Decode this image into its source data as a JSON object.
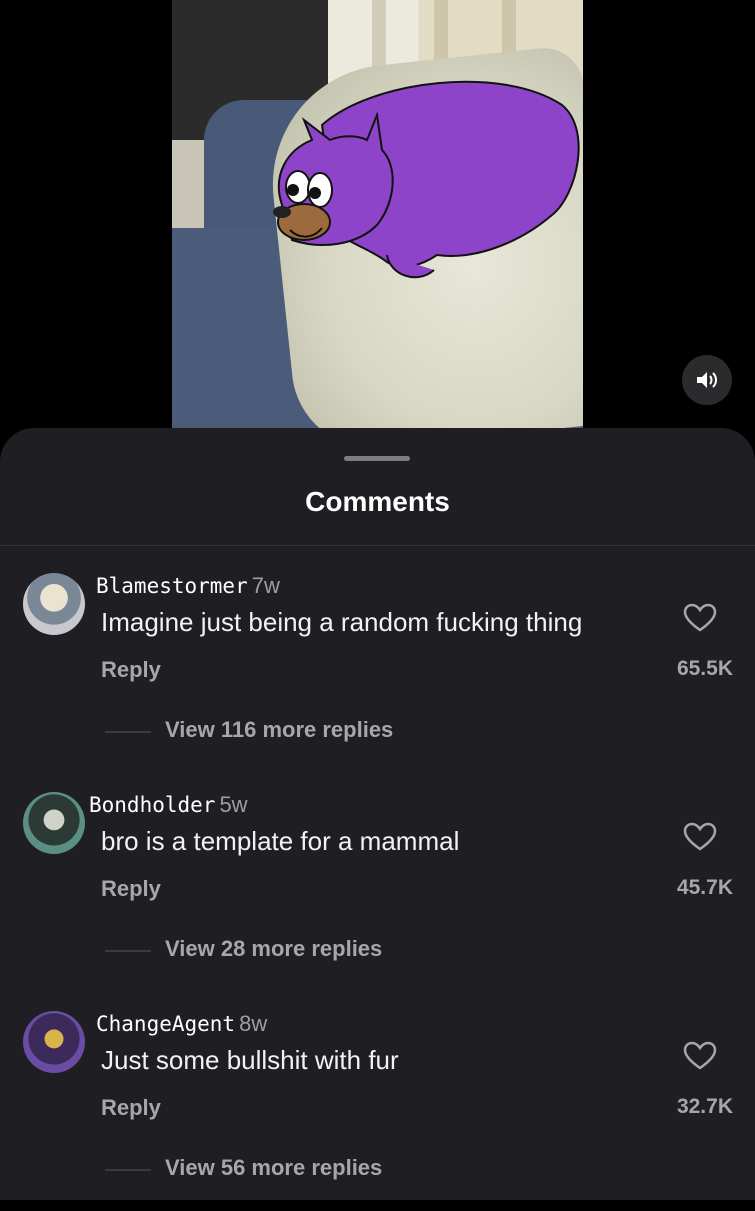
{
  "sheet": {
    "title": "Comments"
  },
  "comments": [
    {
      "username": "Blamestormer",
      "age": "7w",
      "text": "Imagine just being a random fucking thing",
      "reply": "Reply",
      "likes": "65.5K",
      "more": "View 116 more replies"
    },
    {
      "username": "Bondholder",
      "age": "5w",
      "text": "bro is a template for a mammal",
      "reply": "Reply",
      "likes": "45.7K",
      "more": "View 28 more replies"
    },
    {
      "username": "ChangeAgent",
      "age": "8w",
      "text": "Just some bullshit with fur",
      "reply": "Reply",
      "likes": "32.7K",
      "more": "View 56 more replies"
    }
  ],
  "icons": {
    "sound": "speaker-icon",
    "like": "heart-icon"
  },
  "colors": {
    "sheet_bg": "#1f1f23",
    "muted_text": "#a6a6ac",
    "cat_purple": "#8e44c9"
  }
}
